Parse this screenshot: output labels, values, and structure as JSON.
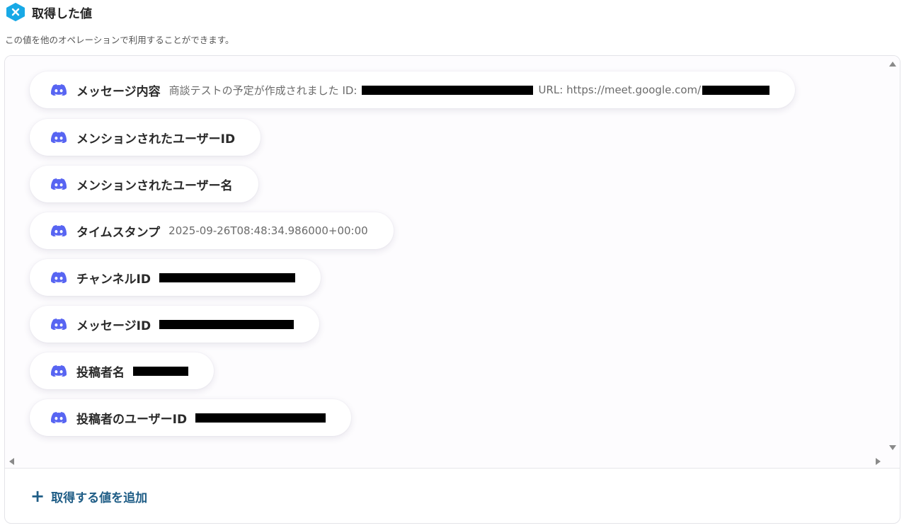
{
  "header": {
    "title": "取得した値",
    "subtitle": "この値を他のオペレーションで利用することができます。"
  },
  "items": [
    {
      "label": "メッセージ内容",
      "value": "商談テストの予定が作成されました ID:",
      "value2": "URL: https://meet.google.com/"
    },
    {
      "label": "メンションされたユーザーID",
      "value": ""
    },
    {
      "label": "メンションされたユーザー名",
      "value": ""
    },
    {
      "label": "タイムスタンプ",
      "value": "2025-09-26T08:48:34.986000+00:00"
    },
    {
      "label": "チャンネルID",
      "value": ""
    },
    {
      "label": "メッセージID",
      "value": ""
    },
    {
      "label": "投稿者名",
      "value": ""
    },
    {
      "label": "投稿者のユーザーID",
      "value": ""
    }
  ],
  "add_button": {
    "label": "取得する値を追加"
  },
  "icons": {
    "header": "yoom-x-icon",
    "item": "discord-icon"
  },
  "colors": {
    "discord": "#5865F2",
    "accent": "#1f5d86",
    "header_icon": "#18a9e6"
  }
}
